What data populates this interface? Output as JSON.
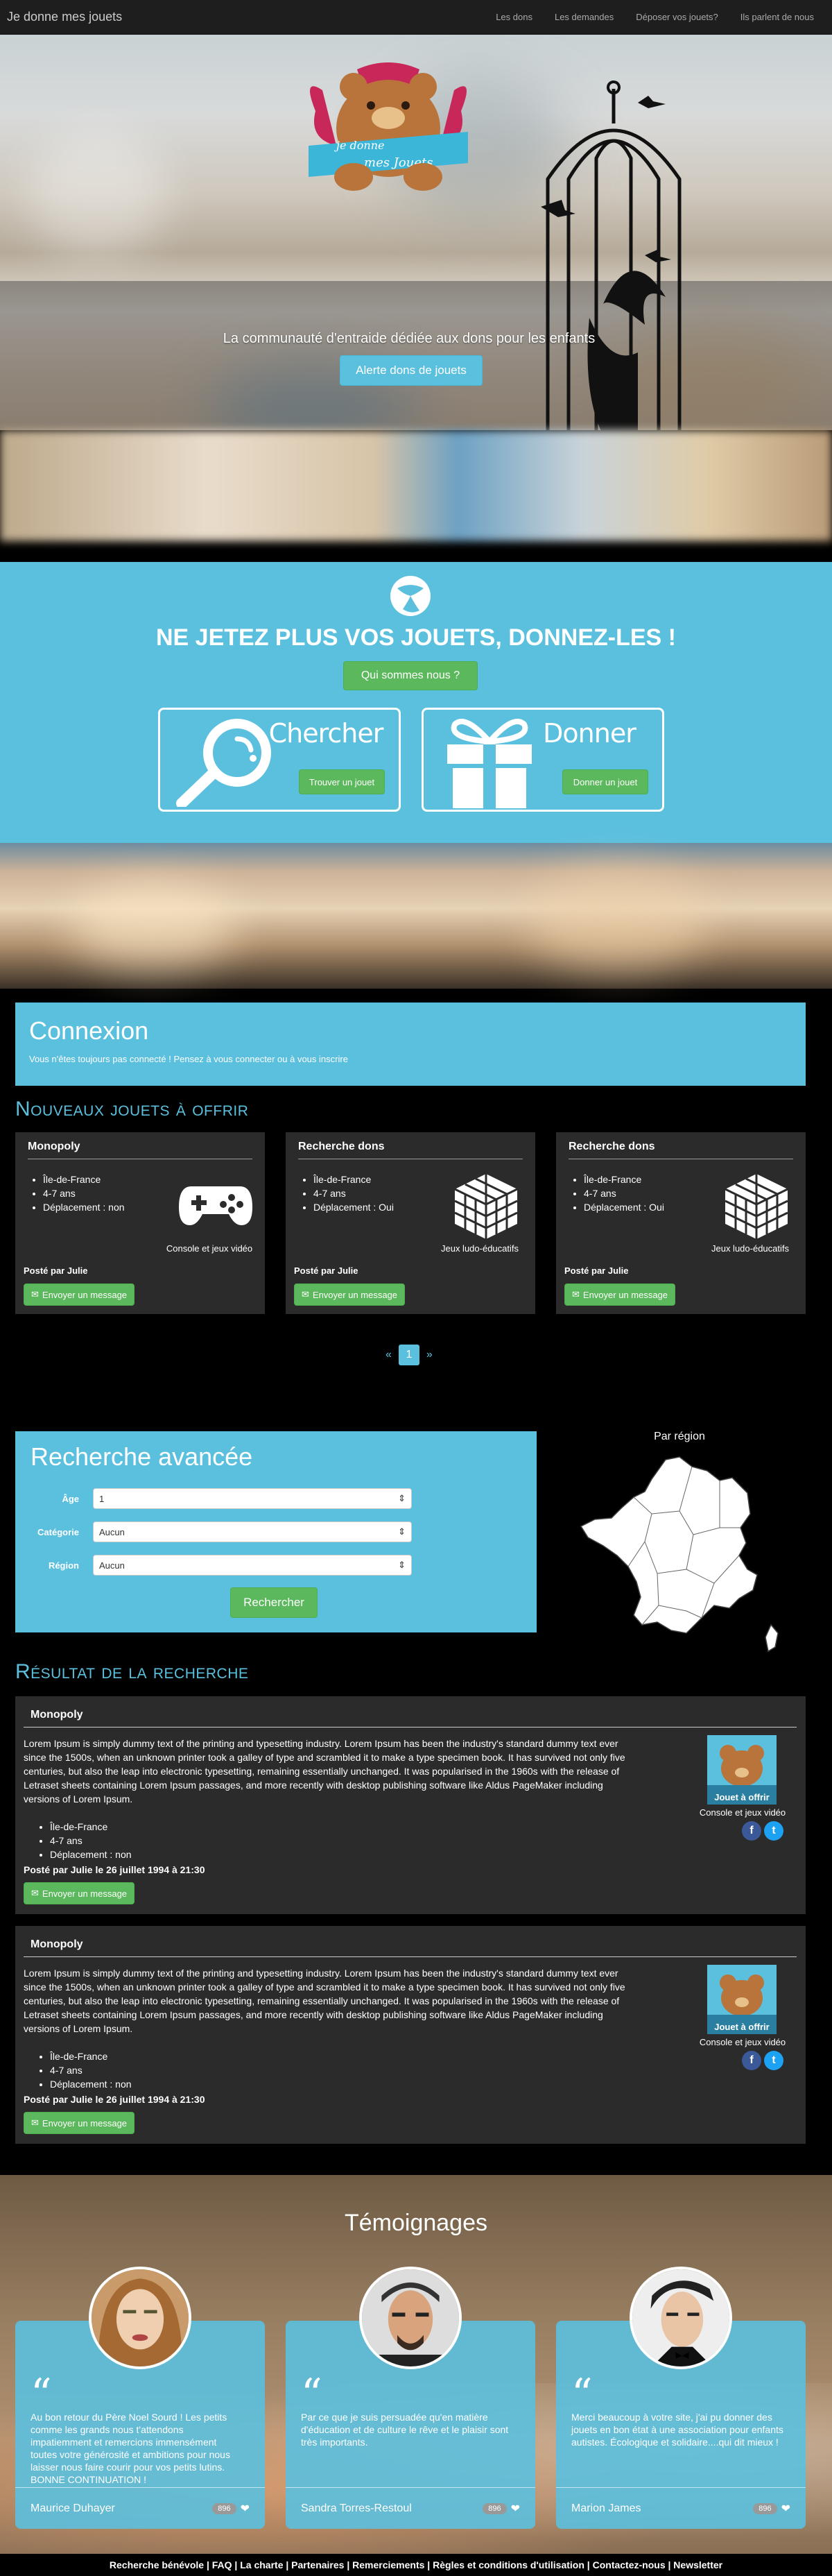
{
  "navbar": {
    "brand": "Je donne mes jouets",
    "links": [
      "Les dons",
      "Les demandes",
      "Déposer vos jouets?",
      "Ils parlent de nous"
    ]
  },
  "hero": {
    "logo_line1": "je donne",
    "logo_line2": "mes Jouets",
    "tagline": "La communauté d'entraide dédiée aux dons pour les enfants",
    "button": "Alerte dons de jouets"
  },
  "intro": {
    "title": "NE JETEZ PLUS VOS JOUETS, DONNEZ-LES !",
    "about_button": "Qui sommes nous ?",
    "search_card": {
      "label": "Chercher",
      "button": "Trouver un jouet"
    },
    "give_card": {
      "label": "Donner",
      "button": "Donner un jouet"
    }
  },
  "connexion": {
    "title": "Connexion",
    "text": "Vous n'êtes toujours pas connecté ! Pensez à vous connecter ou à vous inscrire"
  },
  "new_toys": {
    "title": "Nouveaux jouets à offrir",
    "items": [
      {
        "name": "Monopoly",
        "details": [
          "Île-de-France",
          "4-7 ans",
          "Déplacement : non"
        ],
        "category": "Console et jeux vidéo",
        "icon": "gamepad-icon",
        "posted": "Posté par Julie",
        "button": "Envoyer un message"
      },
      {
        "name": "Recherche dons",
        "details": [
          "Île-de-France",
          "4-7 ans",
          "Déplacement : Oui"
        ],
        "category": "Jeux ludo-éducatifs",
        "icon": "cube-icon",
        "posted": "Posté par Julie",
        "button": "Envoyer un message"
      },
      {
        "name": "Recherche dons",
        "details": [
          "Île-de-France",
          "4-7 ans",
          "Déplacement : Oui"
        ],
        "category": "Jeux ludo-éducatifs",
        "icon": "cube-icon",
        "posted": "Posté par Julie",
        "button": "Envoyer un message"
      }
    ],
    "pager": {
      "prev": "«",
      "current": "1",
      "next": "»"
    }
  },
  "advanced_search": {
    "title": "Recherche avancée",
    "fields": [
      {
        "label": "Âge",
        "value": "1"
      },
      {
        "label": "Catégorie",
        "value": "Aucun"
      },
      {
        "label": "Région",
        "value": "Aucun"
      }
    ],
    "button": "Rechercher",
    "map_title": "Par région"
  },
  "results": {
    "title": "Résultat de la recherche",
    "items": [
      {
        "name": "Monopoly",
        "description": "Lorem Ipsum is simply dummy text of the printing and typesetting industry. Lorem Ipsum has been the industry's standard dummy text ever since the 1500s, when an unknown printer took a galley of type and scrambled it to make a type specimen book. It has survived not only five centuries, but also the leap into electronic typesetting, remaining essentially unchanged. It was popularised in the 1960s with the release of Letraset sheets containing Lorem Ipsum passages, and more recently with desktop publishing software like Aldus PageMaker including versions of Lorem Ipsum.",
        "details": [
          "Île-de-France",
          "4-7 ans",
          "Déplacement : non"
        ],
        "posted": "Posté par Julie le 26 juillet 1994 à 21:30",
        "button": "Envoyer un message",
        "thumb_label": "Jouet à offrir",
        "category": "Console et jeux vidéo"
      },
      {
        "name": "Monopoly",
        "description": "Lorem Ipsum is simply dummy text of the printing and typesetting industry. Lorem Ipsum has been the industry's standard dummy text ever since the 1500s, when an unknown printer took a galley of type and scrambled it to make a type specimen book. It has survived not only five centuries, but also the leap into electronic typesetting, remaining essentially unchanged. It was popularised in the 1960s with the release of Letraset sheets containing Lorem Ipsum passages, and more recently with desktop publishing software like Aldus PageMaker including versions of Lorem Ipsum.",
        "details": [
          "Île-de-France",
          "4-7 ans",
          "Déplacement : non"
        ],
        "posted": "Posté par Julie le 26 juillet 1994 à 21:30",
        "button": "Envoyer un message",
        "thumb_label": "Jouet à offrir",
        "category": "Console et jeux vidéo"
      }
    ]
  },
  "testimonials": {
    "title": "Témoignages",
    "items": [
      {
        "quote": "Au bon retour du Père Noel Sourd ! Les petits comme les grands nous t'attendons impatiemment et remercions immensément toutes votre générosité et ambitions pour nous laisser nous faire courir pour vos petits lutins. BONNE CONTINUATION !",
        "name": "Maurice Duhayer",
        "count": "896"
      },
      {
        "quote": "Par ce que je suis persuadée qu'en matière d'éducation et de culture le rêve et le plaisir sont très importants.",
        "name": "Sandra Torres-Restoul",
        "count": "896"
      },
      {
        "quote": "Merci beaucoup à votre site, j'ai pu donner des jouets en bon état à une association pour enfants autistes. Écologique et solidaire....qui dit mieux !",
        "name": "Marion James",
        "count": "896"
      }
    ]
  },
  "footer": {
    "text": "Recherche bénévole | FAQ | La charte | Partenaires | Remerciements | Règles et conditions d'utilisation | Contactez-nous | Newsletter"
  },
  "colors": {
    "accent": "#5bc0de",
    "success": "#5cb85c",
    "card": "#2b2b2b"
  }
}
